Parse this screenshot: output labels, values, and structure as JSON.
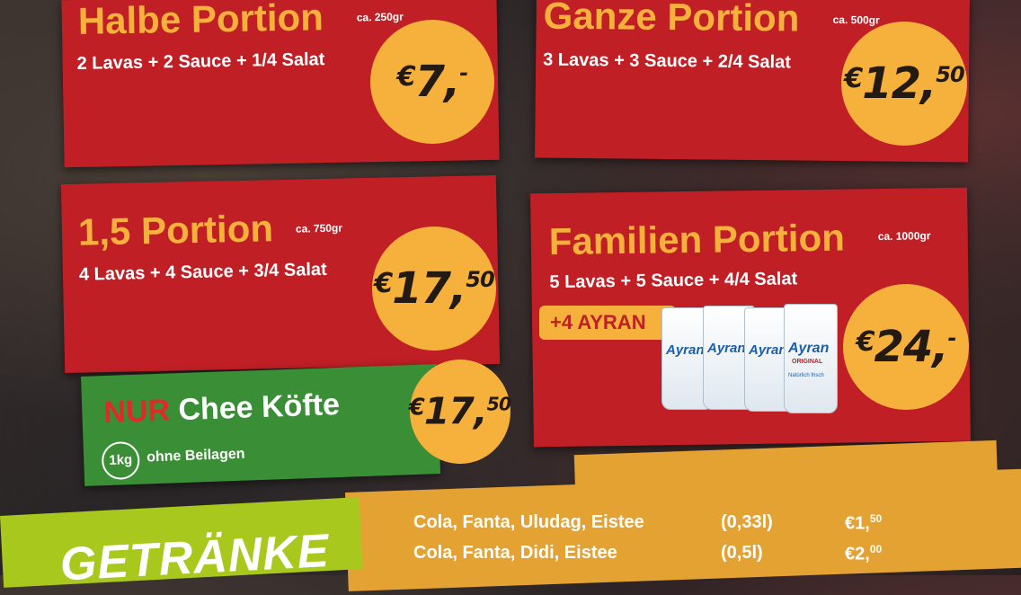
{
  "colors": {
    "panel_red": "#c01f25",
    "accent_yellow": "#f6b13c",
    "green": "#3a8f36",
    "drinks_orange": "#e4a233",
    "lime": "#a8c81e"
  },
  "halbe": {
    "title": "Halbe Portion",
    "weight": "ca. 250gr",
    "desc": "2 Lavas + 2 Sauce + 1/4 Salat",
    "price_euro": "€",
    "price_main": "7,",
    "price_cents": "-"
  },
  "ganze": {
    "title": "Ganze Portion",
    "weight": "ca. 500gr",
    "desc": "3 Lavas + 3 Sauce + 2/4 Salat",
    "price_euro": "€",
    "price_main": "12,",
    "price_cents": "50"
  },
  "eins_fuenf": {
    "title": "1,5 Portion",
    "weight": "ca. 750gr",
    "desc": "4 Lavas + 4 Sauce + 3/4 Salat",
    "price_euro": "€",
    "price_main": "17,",
    "price_cents": "50"
  },
  "familien": {
    "title": "Familien Portion",
    "weight": "ca. 1000gr",
    "desc": "5 Lavas + 5 Sauce + 4/4 Salat",
    "extra": "+4 AYRAN",
    "cup_brand": "Ayran",
    "cup_sub": "ORIGINAL",
    "cup_note": "Natürlich frisch",
    "price_euro": "€",
    "price_main": "24,",
    "price_cents": "-"
  },
  "koefte": {
    "nur": "NUR",
    "title": "Chee Köfte",
    "circle": "1kg",
    "note": "ohne Beilagen",
    "price_euro": "€",
    "price_main": "17,",
    "price_cents": "50"
  },
  "getraenke": {
    "heading": "GETRÄNKE",
    "rows": [
      {
        "name": "Cola, Fanta, Uludag, Eistee",
        "size": "(0,33l)",
        "price": "€1,",
        "cents": "50"
      },
      {
        "name": "Cola, Fanta, Didi, Eistee",
        "size": "(0,5l)",
        "price": "€2,",
        "cents": "00"
      }
    ]
  }
}
